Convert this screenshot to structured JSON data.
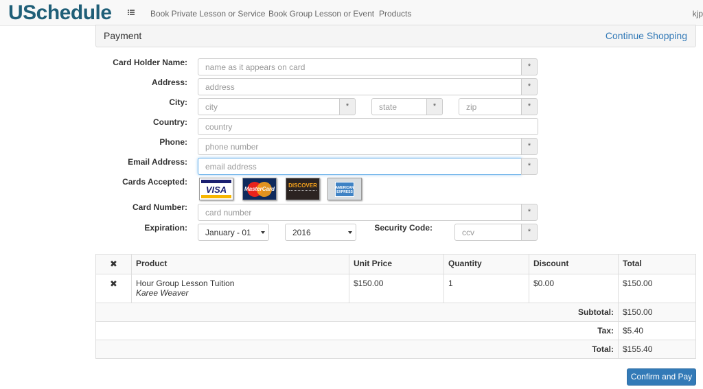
{
  "nav": {
    "brand": "USchedule",
    "links": [
      "Book Private Lesson or Service",
      "Book Group Lesson or Event",
      "Products"
    ],
    "user": "kjp"
  },
  "panel": {
    "title": "Payment",
    "continue": "Continue Shopping"
  },
  "form": {
    "card_holder": {
      "label": "Card Holder Name:",
      "placeholder": "name as it appears on card"
    },
    "address": {
      "label": "Address:",
      "placeholder": "address"
    },
    "city": {
      "label": "City:",
      "placeholder": "city"
    },
    "state": {
      "placeholder": "state"
    },
    "zip": {
      "placeholder": "zip"
    },
    "country": {
      "label": "Country:",
      "placeholder": "country"
    },
    "phone": {
      "label": "Phone:",
      "placeholder": "phone number"
    },
    "email": {
      "label": "Email Address:",
      "placeholder": "email address"
    },
    "cards": {
      "label": "Cards Accepted:",
      "visa": "VISA",
      "mastercard": "MasterCard",
      "discover": "DISCOVER",
      "amex": "AMERICAN EXPRESS"
    },
    "card_number": {
      "label": "Card Number:",
      "placeholder": "card number"
    },
    "expiration": {
      "label": "Expiration:",
      "month": "January - 01",
      "year": "2016"
    },
    "security": {
      "label": "Security Code:",
      "placeholder": "ccv"
    },
    "required": "*"
  },
  "table": {
    "headers": {
      "remove": "✖",
      "product": "Product",
      "unit_price": "Unit Price",
      "quantity": "Quantity",
      "discount": "Discount",
      "total": "Total"
    },
    "row": {
      "remove": "✖",
      "product": "Hour Group Lesson Tuition",
      "teacher": "Karee Weaver",
      "unit_price": "$150.00",
      "quantity": "1",
      "discount": "$0.00",
      "total": "$150.00"
    },
    "subtotal": {
      "label": "Subtotal:",
      "value": "$150.00"
    },
    "tax": {
      "label": "Tax:",
      "value": "$5.40"
    },
    "grand_total": {
      "label": "Total:",
      "value": "$155.40"
    }
  },
  "button": {
    "confirm": "Confirm and Pay"
  }
}
